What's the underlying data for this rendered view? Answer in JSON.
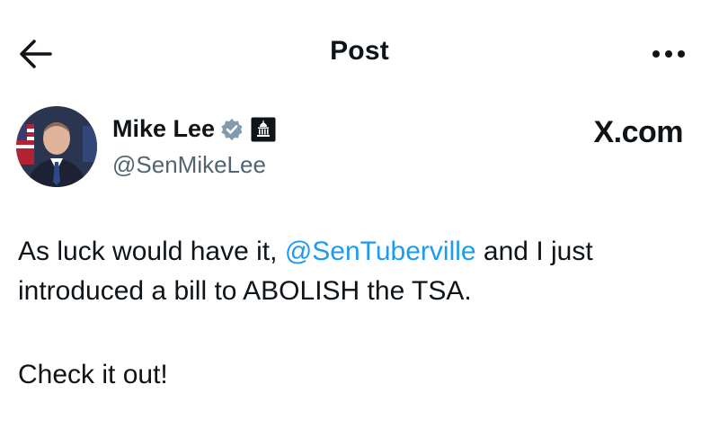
{
  "header": {
    "title": "Post"
  },
  "author": {
    "name": "Mike Lee",
    "handle": "@SenMikeLee",
    "verified": true,
    "badge": "government-building-icon"
  },
  "brand": {
    "label": "X.com"
  },
  "tweet": {
    "text_before": "As luck would have it, ",
    "mention": "@SenTuberville",
    "text_after": " and I just introduced a bill to ABOLISH the TSA.",
    "text_second_paragraph": "Check it out!"
  },
  "colors": {
    "text": "#0f1419",
    "secondary": "#536471",
    "link": "#1d9bf0",
    "verified_badge": "#829aab"
  }
}
